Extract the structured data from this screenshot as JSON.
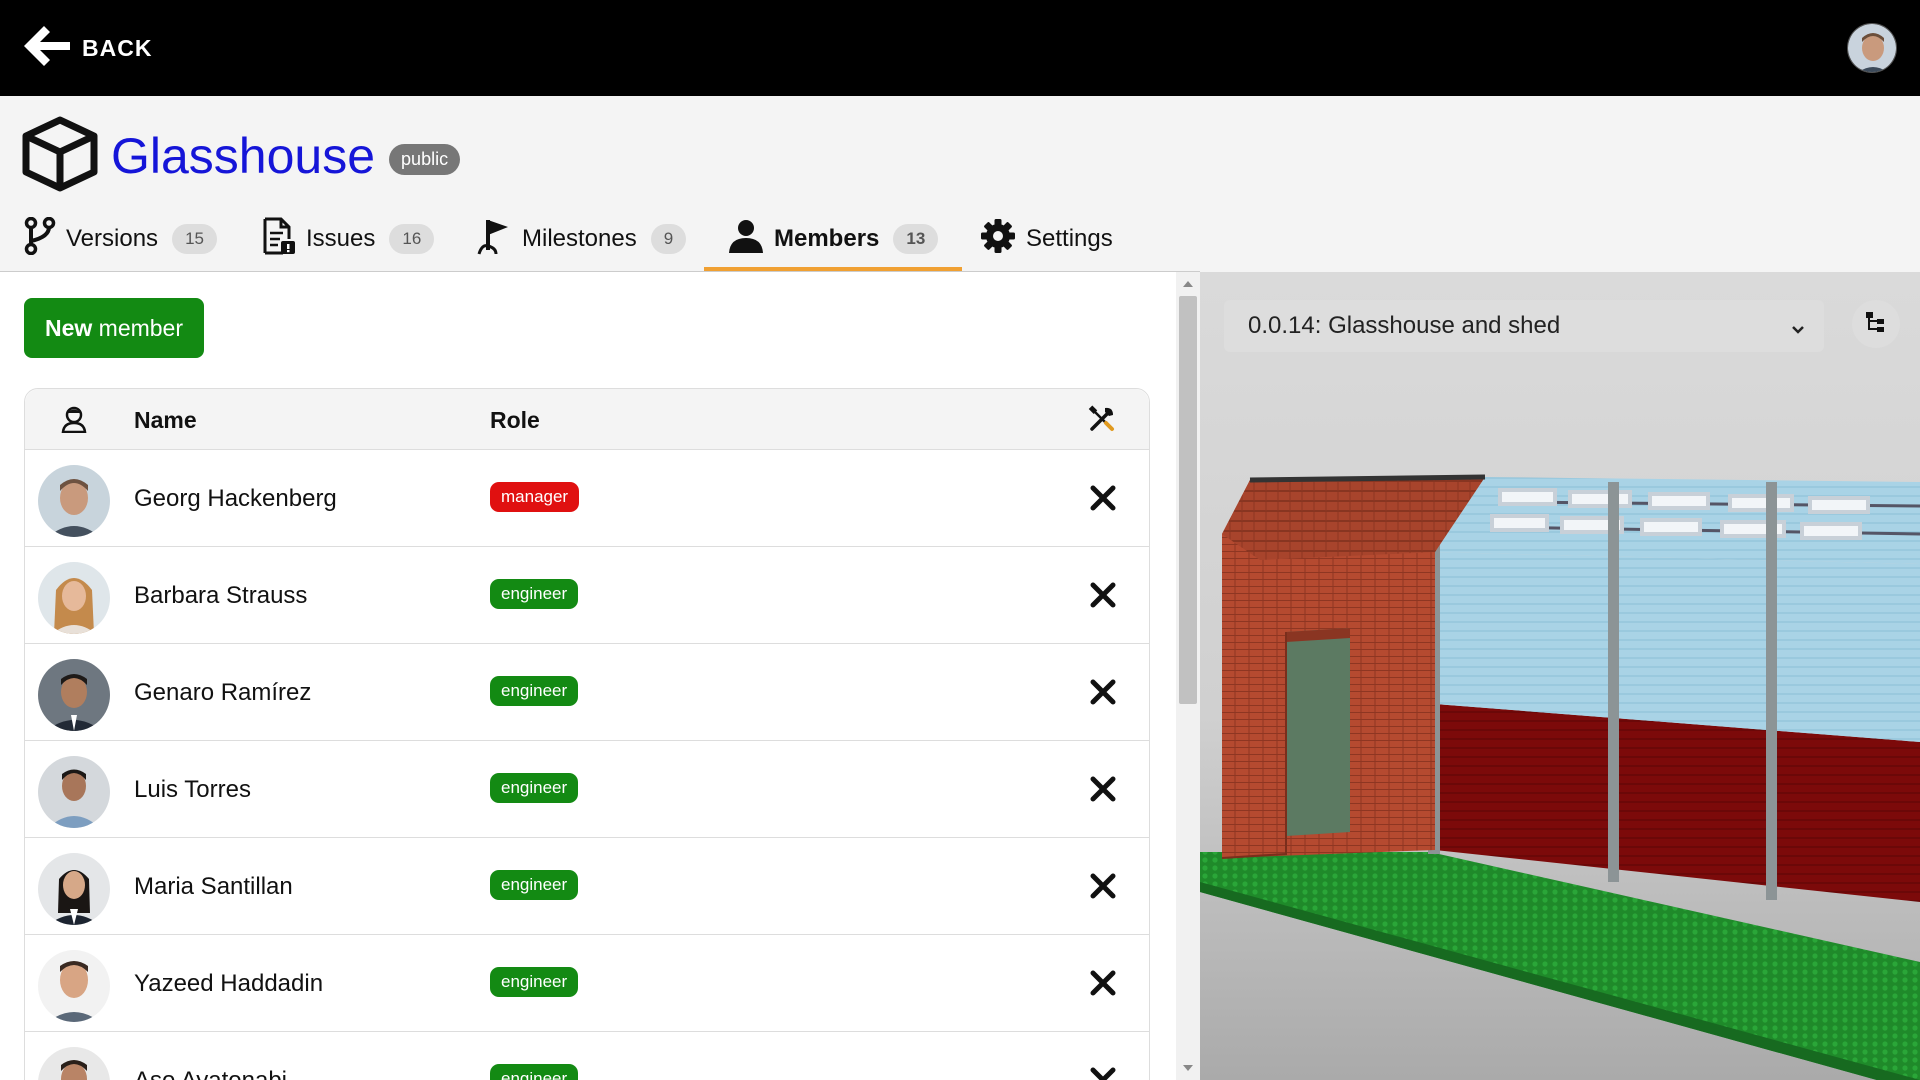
{
  "topbar": {
    "back_label": "BACK"
  },
  "project": {
    "name": "Glasshouse",
    "visibility": "public"
  },
  "tabs": [
    {
      "label": "Versions",
      "count": "15",
      "active": false
    },
    {
      "label": "Issues",
      "count": "16",
      "active": false
    },
    {
      "label": "Milestones",
      "count": "9",
      "active": false
    },
    {
      "label": "Members",
      "count": "13",
      "active": true
    },
    {
      "label": "Settings",
      "active": false
    }
  ],
  "members": {
    "new_button": {
      "bold": "New",
      "rest": " member"
    },
    "columns": {
      "name": "Name",
      "role": "Role"
    },
    "rows": [
      {
        "name": "Georg Hackenberg",
        "role": "manager"
      },
      {
        "name": "Barbara Strauss",
        "role": "engineer"
      },
      {
        "name": "Genaro Ramírez",
        "role": "engineer"
      },
      {
        "name": "Luis Torres",
        "role": "engineer"
      },
      {
        "name": "Maria Santillan",
        "role": "engineer"
      },
      {
        "name": "Yazeed Haddadin",
        "role": "engineer"
      },
      {
        "name": "Aso Ayatonabi",
        "role": "engineer"
      }
    ]
  },
  "viewer": {
    "selected_version": "0.0.14: Glasshouse and shed"
  },
  "colors": {
    "accent": "#f0a032",
    "manager": "#e01010",
    "engineer": "#138a13",
    "title": "#1515d8"
  }
}
